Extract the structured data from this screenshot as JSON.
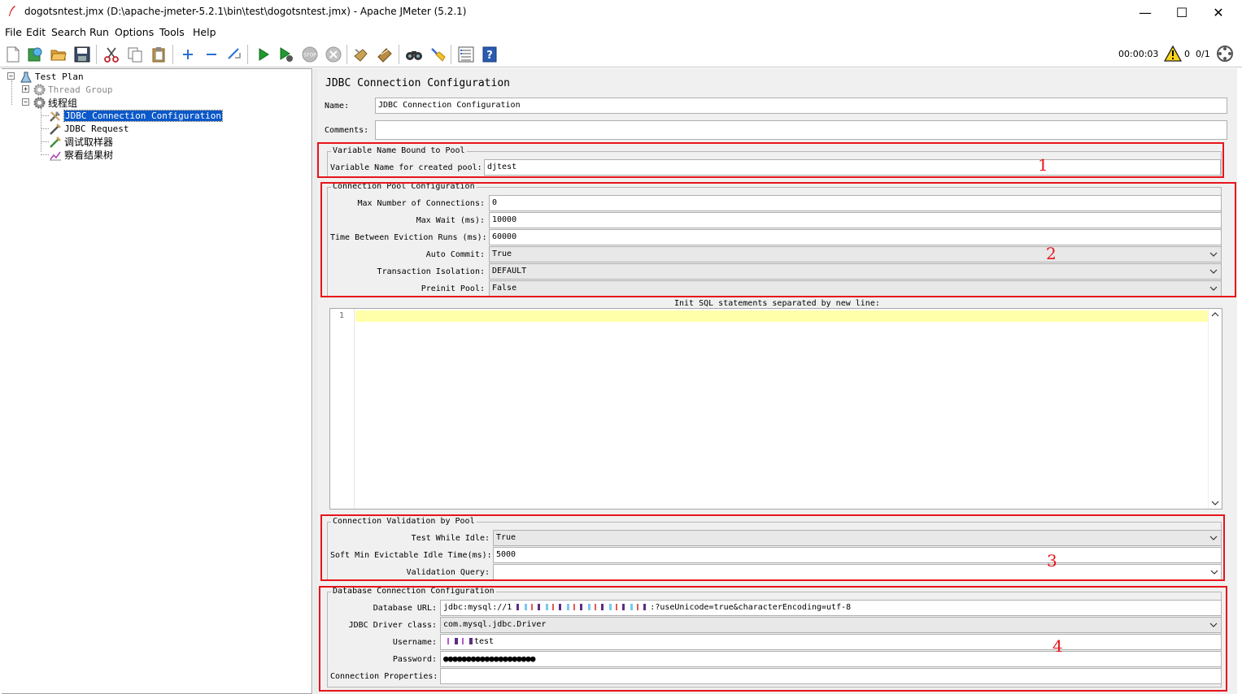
{
  "window": {
    "title": "dogotsntest.jmx (D:\\apache-jmeter-5.2.1\\bin\\test\\dogotsntest.jmx) - Apache JMeter (5.2.1)",
    "minimize": "—",
    "maximize": "☐",
    "close": "✕"
  },
  "menu": [
    "File",
    "Edit",
    "Search",
    "Run",
    "Options",
    "Tools",
    "Help"
  ],
  "toolbar": {
    "timer": "00:00:03",
    "error_count": "0",
    "thread_count": "0/1",
    "icons": [
      "new-icon",
      "templates-icon",
      "open-icon",
      "save-icon",
      "cut-icon",
      "copy-icon",
      "paste-icon",
      "expand-icon",
      "collapse-icon",
      "toggle-icon",
      "start-icon",
      "start-no-pause-icon",
      "stop-icon",
      "shutdown-icon",
      "clear-icon",
      "clear-all-icon",
      "search-icon",
      "reset-search-icon",
      "function-helper-icon",
      "help-icon"
    ]
  },
  "tree": {
    "test_plan": "Test Plan",
    "thread_group": "Thread Group",
    "thread_group_cn": "线程组",
    "jdbc_config": "JDBC Connection Configuration",
    "jdbc_request": "JDBC Request",
    "debug_sampler": "调试取样器",
    "result_tree": "察看结果树"
  },
  "panel": {
    "title": "JDBC Connection Configuration",
    "name_label": "Name:",
    "name_value": "JDBC Connection Configuration",
    "comments_label": "Comments:",
    "comments_value": "",
    "var_group": "Variable Name Bound to Pool",
    "var_label": "Variable Name for created pool:",
    "var_value": "djtest",
    "pool_group": "Connection Pool Configuration",
    "max_conn_label": "Max Number of Connections:",
    "max_conn_value": "0",
    "max_wait_label": "Max Wait (ms):",
    "max_wait_value": "10000",
    "eviction_label": "Time Between Eviction Runs (ms):",
    "eviction_value": "60000",
    "auto_commit_label": "Auto Commit:",
    "auto_commit_value": "True",
    "isolation_label": "Transaction Isolation:",
    "isolation_value": "DEFAULT",
    "preinit_label": "Preinit Pool:",
    "preinit_value": "False",
    "init_sql_label": "Init SQL statements separated by new line:",
    "init_sql_line_no": "1",
    "validation_group": "Connection Validation by Pool",
    "test_idle_label": "Test While Idle:",
    "test_idle_value": "True",
    "soft_min_label": "Soft Min Evictable Idle Time(ms):",
    "soft_min_value": "5000",
    "validation_query_label": "Validation Query:",
    "validation_query_value": "",
    "db_group": "Database Connection Configuration",
    "db_url_label": "Database URL:",
    "db_url_prefix": "jdbc:mysql://1",
    "db_url_suffix": ":?useUnicode=true&characterEncoding=utf-8",
    "driver_label": "JDBC Driver class:",
    "driver_value": "com.mysql.jdbc.Driver",
    "username_label": "Username:",
    "username_value": "test",
    "password_label": "Password:",
    "password_value": "●●●●●●●●●●●●●●●●●●●●",
    "conn_props_label": "Connection Properties:",
    "conn_props_value": ""
  },
  "annotations": [
    "1",
    "2",
    "3",
    "4"
  ],
  "colors": {
    "annotation_red": "#e8141b",
    "selection_blue": "#0a58c9",
    "panel_bg": "#f0f0f0",
    "editor_highlight": "#ffffaa"
  }
}
